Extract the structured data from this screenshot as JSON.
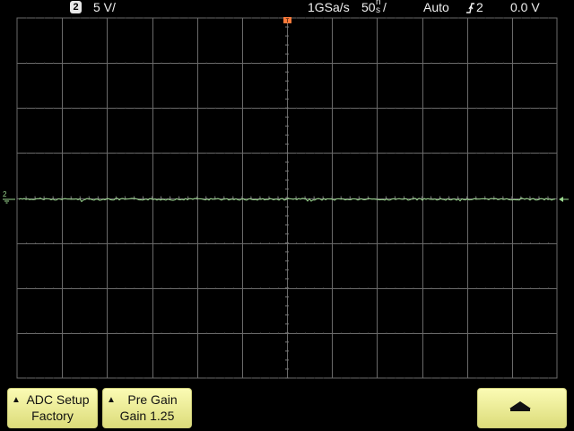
{
  "status_bar": {
    "channel_number": "2",
    "volts_per_div": "5 V/",
    "sample_rate": "1GSa/s",
    "time_per_div_value": "50",
    "time_per_div_unit_top": "n",
    "time_per_div_unit_bottom": "s",
    "time_per_div_slash": "/",
    "trigger_mode": "Auto",
    "trigger_source": "2",
    "trigger_level": "0.0 V"
  },
  "display": {
    "background_color": "#000000",
    "grid_color": "#6a6a6a",
    "trace_color": "#9bd88f",
    "trigger_marker_color": "#ff7a3a",
    "channel_marker_label": "2",
    "ground_marker_symbol": "⏚"
  },
  "softkeys": [
    {
      "line1": "ADC Setup",
      "line2": "Factory",
      "arrow_icon": "triangle-up-icon"
    },
    {
      "line1": "Pre Gain",
      "line2": "Gain 1.25",
      "arrow_icon": "triangle-up-icon"
    },
    {
      "icon": "arrow-up-icon"
    }
  ]
}
